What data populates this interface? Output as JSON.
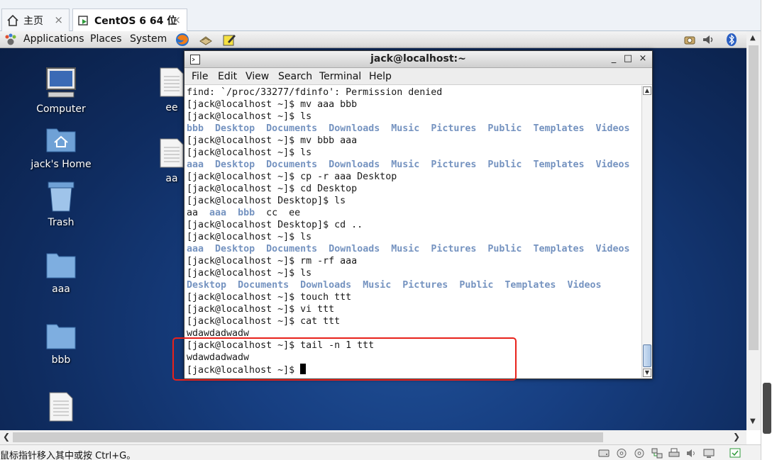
{
  "tabs": [
    {
      "label": "主页",
      "close": "×"
    },
    {
      "label": "CentOS 6 64 位",
      "close": "×"
    }
  ],
  "gnome_panel": {
    "applications": "Applications",
    "places": "Places",
    "system": "System"
  },
  "desktop_icons": {
    "computer": "Computer",
    "home": "jack's Home",
    "trash": "Trash",
    "aaa": "aaa",
    "bbb": "bbb",
    "ee": "ee",
    "aa": "aa"
  },
  "terminal": {
    "title": "jack@localhost:~",
    "menu": {
      "file": "File",
      "edit": "Edit",
      "view": "View",
      "search": "Search",
      "terminal": "Terminal",
      "help": "Help"
    },
    "lines": [
      "find: `/proc/33277/fdinfo': Permission denied",
      "[jack@localhost ~]$ mv aaa bbb",
      "[jack@localhost ~]$ ls",
      "bbb  Desktop  Documents  Downloads  Music  Pictures  Public  Templates  Videos",
      "[jack@localhost ~]$ mv bbb aaa",
      "[jack@localhost ~]$ ls",
      "aaa  Desktop  Documents  Downloads  Music  Pictures  Public  Templates  Videos",
      "[jack@localhost ~]$ cp -r aaa Desktop",
      "[jack@localhost ~]$ cd Desktop",
      "[jack@localhost Desktop]$ ls",
      "aa  aaa  bbb  cc  ee",
      "[jack@localhost Desktop]$ cd ..",
      "[jack@localhost ~]$ ls",
      "aaa  Desktop  Documents  Downloads  Music  Pictures  Public  Templates  Videos",
      "[jack@localhost ~]$ rm -rf aaa",
      "[jack@localhost ~]$ ls",
      "Desktop  Documents  Downloads  Music  Pictures  Public  Templates  Videos",
      "[jack@localhost ~]$ touch ttt",
      "[jack@localhost ~]$ vi ttt",
      "[jack@localhost ~]$ cat ttt",
      "wdawdadwadw",
      "[jack@localhost ~]$ tail -n 1 ttt",
      "wdawdadwadw",
      "[jack@localhost ~]$ "
    ],
    "dir_entries": [
      "bbb",
      "Desktop",
      "Documents",
      "Downloads",
      "Music",
      "Pictures",
      "Public",
      "Templates",
      "Videos",
      "aaa"
    ]
  },
  "status_text": "鼠标指针移入其中或按 Ctrl+G。",
  "colors": {
    "dir_blue": "#7593c0",
    "highlight": "#e8221b"
  }
}
